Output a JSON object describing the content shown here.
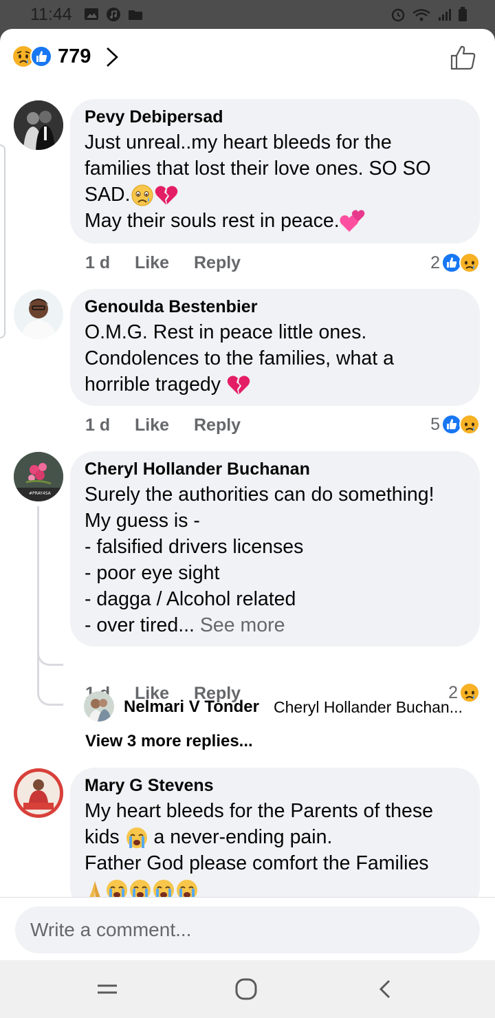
{
  "status_bar": {
    "time": "11:44"
  },
  "header": {
    "reaction_count": "779"
  },
  "comments": [
    {
      "author": "Pevy Debipersad",
      "lines": [
        "Just unreal..my heart  bleeds  for the",
        "families  that lost their  love ones. SO SO",
        "SAD.",
        "May their souls  rest in peace."
      ],
      "time": "1 d",
      "like_label": "Like",
      "reply_label": "Reply",
      "reaction_count": "2"
    },
    {
      "author": "Genoulda Bestenbier",
      "lines": [
        "O.M.G. Rest in peace little ones.",
        "Condolences to the families, what a",
        "horrible tragedy"
      ],
      "time": "1 d",
      "like_label": "Like",
      "reply_label": "Reply",
      "reaction_count": "5"
    },
    {
      "author": "Cheryl Hollander Buchanan",
      "lines": [
        "Surely the authorities can do something!",
        "My guess is -",
        "- falsified drivers licenses",
        "- poor eye sight",
        "- dagga / Alcohol related",
        "- over tired..."
      ],
      "see_more": "See more",
      "avatar_caption": "#PRAY4SA",
      "time": "1 d",
      "like_label": "Like",
      "reply_label": "Reply",
      "reaction_count": "2",
      "reply_preview": {
        "author": "Nelmari V Tonder",
        "text": "Cheryl Hollander Buchan..."
      },
      "view_more": "View 3 more replies..."
    },
    {
      "author": "Mary G Stevens",
      "lines": [
        "My heart bleeds for the Parents of these",
        "kids",
        " a never-ending pain.",
        "Father God please comfort the Families"
      ]
    }
  ],
  "composer": {
    "placeholder": "Write a comment..."
  },
  "icons": [
    "gallery-icon",
    "music-icon",
    "folder-icon",
    "alarm-icon",
    "wifi-icon",
    "signal-icon",
    "battery-icon",
    "sad-reaction-icon",
    "like-reaction-icon",
    "chevron-right-icon",
    "thumbs-up-outline-icon",
    "crying-face-icon",
    "broken-heart-icon",
    "two-hearts-icon",
    "loudly-crying-face-icon",
    "praying-hands-icon",
    "recent-apps-icon",
    "home-icon",
    "back-icon"
  ],
  "colors": {
    "like_blue": "#1877f2",
    "sad_yellow": "#f7b125",
    "bubble_grey": "#f0f2f5",
    "meta_grey": "#65676b",
    "broken_heart": "#e41e65"
  }
}
